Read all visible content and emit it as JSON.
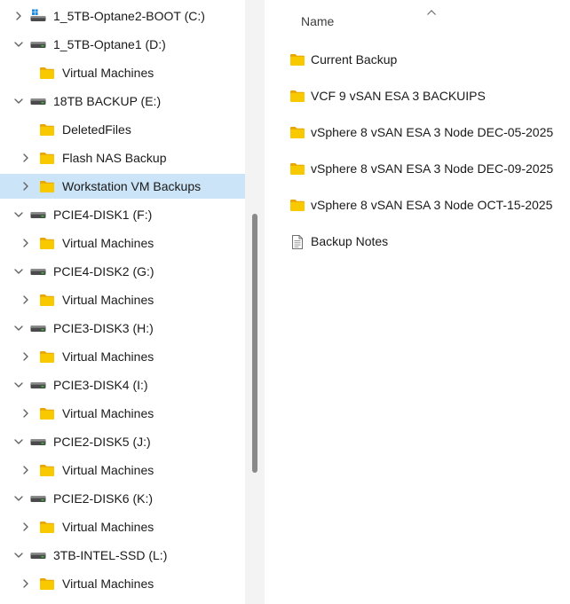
{
  "nav_tree": {
    "items": [
      {
        "label": "1_5TB-Optane2-BOOT (C:)",
        "type": "drive",
        "icon": "windows-drive-icon",
        "expand_state": "collapsed",
        "level": 0
      },
      {
        "label": "1_5TB-Optane1 (D:)",
        "type": "drive",
        "icon": "drive-icon",
        "expand_state": "expanded",
        "level": 0
      },
      {
        "label": "Virtual Machines",
        "type": "folder",
        "icon": "folder-icon",
        "expand_state": "none",
        "level": 1
      },
      {
        "label": "18TB BACKUP (E:)",
        "type": "drive",
        "icon": "drive-icon",
        "expand_state": "expanded",
        "level": 0
      },
      {
        "label": "DeletedFiles",
        "type": "folder",
        "icon": "folder-icon",
        "expand_state": "none",
        "level": 1
      },
      {
        "label": "Flash NAS Backup",
        "type": "folder",
        "icon": "folder-icon",
        "expand_state": "collapsed",
        "level": 1
      },
      {
        "label": "Workstation VM Backups",
        "type": "folder",
        "icon": "folder-icon",
        "expand_state": "collapsed",
        "level": 1,
        "selected": true
      },
      {
        "label": "PCIE4-DISK1 (F:)",
        "type": "drive",
        "icon": "drive-icon",
        "expand_state": "expanded",
        "level": 0
      },
      {
        "label": "Virtual Machines",
        "type": "folder",
        "icon": "folder-icon",
        "expand_state": "collapsed",
        "level": 1
      },
      {
        "label": "PCIE4-DISK2 (G:)",
        "type": "drive",
        "icon": "drive-icon",
        "expand_state": "expanded",
        "level": 0
      },
      {
        "label": "Virtual Machines",
        "type": "folder",
        "icon": "folder-icon",
        "expand_state": "collapsed",
        "level": 1
      },
      {
        "label": "PCIE3-DISK3 (H:)",
        "type": "drive",
        "icon": "drive-icon",
        "expand_state": "expanded",
        "level": 0
      },
      {
        "label": "Virtual Machines",
        "type": "folder",
        "icon": "folder-icon",
        "expand_state": "collapsed",
        "level": 1
      },
      {
        "label": "PCIE3-DISK4 (I:)",
        "type": "drive",
        "icon": "drive-icon",
        "expand_state": "expanded",
        "level": 0
      },
      {
        "label": "Virtual Machines",
        "type": "folder",
        "icon": "folder-icon",
        "expand_state": "collapsed",
        "level": 1
      },
      {
        "label": "PCIE2-DISK5 (J:)",
        "type": "drive",
        "icon": "drive-icon",
        "expand_state": "expanded",
        "level": 0
      },
      {
        "label": "Virtual Machines",
        "type": "folder",
        "icon": "folder-icon",
        "expand_state": "collapsed",
        "level": 1
      },
      {
        "label": "PCIE2-DISK6 (K:)",
        "type": "drive",
        "icon": "drive-icon",
        "expand_state": "expanded",
        "level": 0
      },
      {
        "label": "Virtual Machines",
        "type": "folder",
        "icon": "folder-icon",
        "expand_state": "collapsed",
        "level": 1
      },
      {
        "label": "3TB-INTEL-SSD (L:)",
        "type": "drive",
        "icon": "drive-icon",
        "expand_state": "expanded",
        "level": 0
      },
      {
        "label": "Virtual Machines",
        "type": "folder",
        "icon": "folder-icon",
        "expand_state": "collapsed",
        "level": 1
      }
    ]
  },
  "file_list": {
    "column_header": {
      "name_label": "Name",
      "sort": "ascending",
      "sort_icon": "sort-up-chevron-icon"
    },
    "items": [
      {
        "label": "Current Backup",
        "type": "folder",
        "icon": "folder-icon"
      },
      {
        "label": "VCF 9 vSAN ESA 3 BACKUIPS",
        "type": "folder",
        "icon": "folder-icon"
      },
      {
        "label": "vSphere 8 vSAN ESA 3 Node DEC-05-2025",
        "type": "folder",
        "icon": "folder-icon"
      },
      {
        "label": "vSphere 8 vSAN ESA 3 Node DEC-09-2025",
        "type": "folder",
        "icon": "folder-icon"
      },
      {
        "label": "vSphere 8 vSAN ESA 3 Node OCT-15-2025",
        "type": "folder",
        "icon": "folder-icon"
      },
      {
        "label": "Backup Notes",
        "type": "document",
        "icon": "text-document-icon"
      }
    ]
  },
  "colors": {
    "selected_row": "#cce4f7",
    "folder_body": "#f9c900",
    "folder_tab": "#e8a400",
    "chevron": "#5f5f5f",
    "scrollbar_thumb": "#8a8a8a",
    "pane_gap": "#f3f3f3"
  }
}
